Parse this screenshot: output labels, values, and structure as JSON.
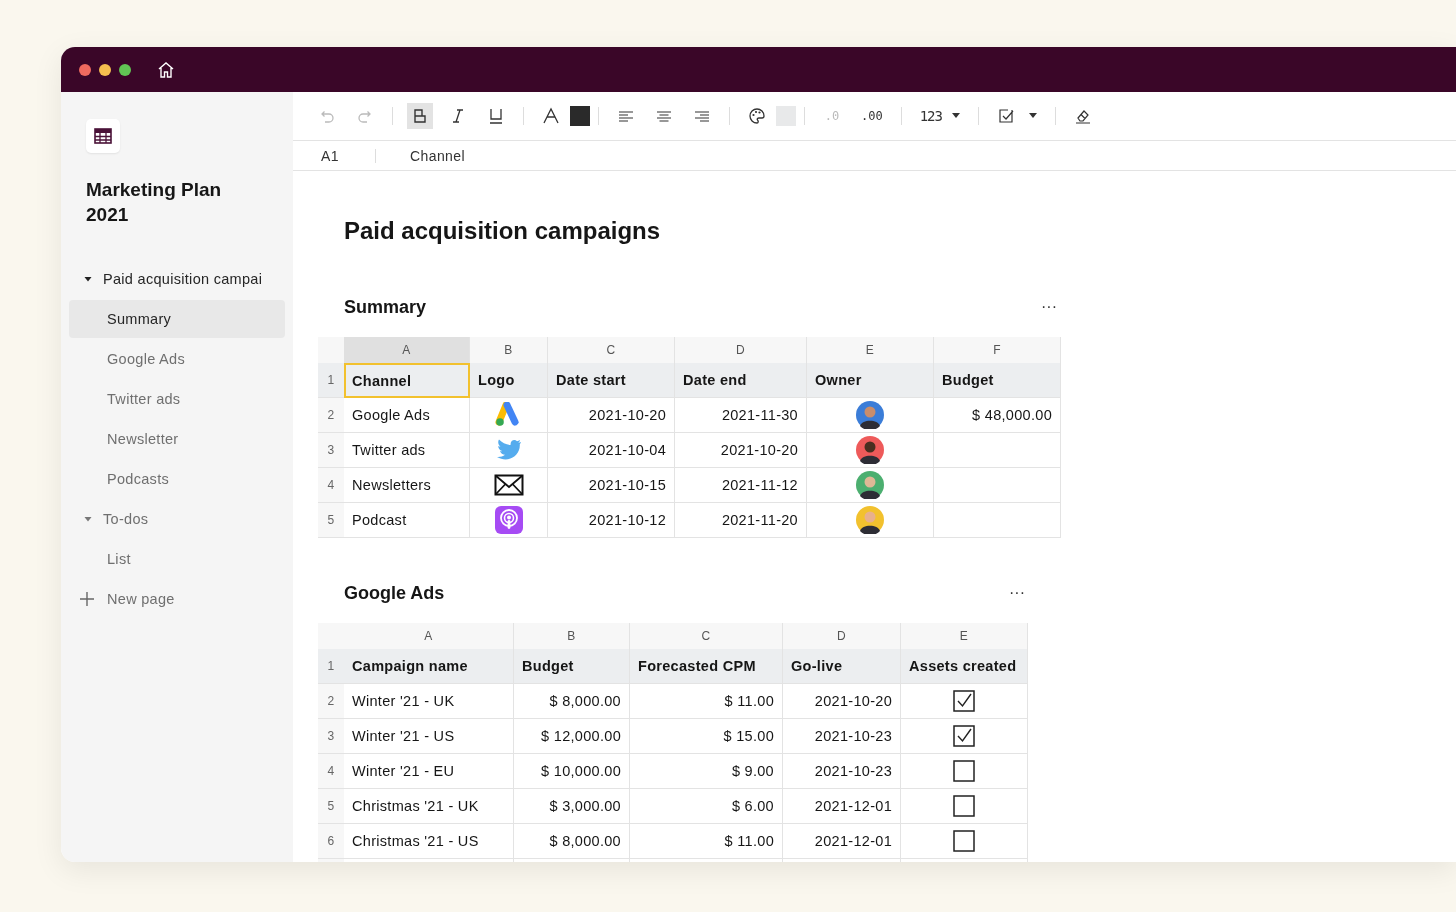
{
  "toolbar": {
    "bold": {
      "selected": true
    },
    "number_format": "123",
    "decrease_decimals": ".0",
    "increase_decimals": ".00"
  },
  "formula_bar": {
    "cell": "A1",
    "value": "Channel"
  },
  "sidebar": {
    "document_title": "Marketing Plan 2021",
    "items": [
      {
        "label": "Paid acquisition campai",
        "expanded": true,
        "selected": false,
        "children": [
          {
            "label": "Summary",
            "selected": true
          },
          {
            "label": "Google Ads",
            "selected": false
          },
          {
            "label": "Twitter ads",
            "selected": false
          },
          {
            "label": "Newsletter",
            "selected": false
          },
          {
            "label": "Podcasts",
            "selected": false
          }
        ]
      },
      {
        "label": "To-dos",
        "expanded": true,
        "selected": false,
        "children": [
          {
            "label": "List",
            "selected": false
          }
        ]
      }
    ],
    "new_page": "New page"
  },
  "page_title": "Paid acquisition campaigns",
  "summary": {
    "title": "Summary",
    "menu": "···",
    "header_row_number": "1",
    "columns": [
      {
        "letter": "A",
        "header": "Channel",
        "selected": true
      },
      {
        "letter": "B",
        "header": "Logo",
        "selected": false
      },
      {
        "letter": "C",
        "header": "Date start",
        "selected": false
      },
      {
        "letter": "D",
        "header": "Date end",
        "selected": false
      },
      {
        "letter": "E",
        "header": "Owner",
        "selected": false
      },
      {
        "letter": "F",
        "header": "Budget",
        "selected": false
      }
    ],
    "rows": [
      {
        "number": "2",
        "channel": "Google Ads",
        "date_start": "2021-10-20",
        "date_end": "2021-11-30",
        "budget": "$ 48,000.00"
      },
      {
        "number": "3",
        "channel": "Twitter ads",
        "date_start": "2021-10-04",
        "date_end": "2021-10-20"
      },
      {
        "number": "4",
        "channel": "Newsletters",
        "date_start": "2021-10-15",
        "date_end": "2021-11-12"
      },
      {
        "number": "5",
        "channel": "Podcast",
        "date_start": "2021-10-12",
        "date_end": "2021-11-20"
      }
    ]
  },
  "google_ads": {
    "title": "Google Ads",
    "menu": "···",
    "header_row_number": "1",
    "columns": [
      {
        "letter": "A",
        "header": "Campaign name"
      },
      {
        "letter": "B",
        "header": "Budget"
      },
      {
        "letter": "C",
        "header": "Forecasted CPM"
      },
      {
        "letter": "D",
        "header": "Go-live"
      },
      {
        "letter": "E",
        "header": "Assets created"
      }
    ],
    "rows": [
      {
        "number": "2",
        "name": "Winter '21 - UK",
        "budget": "$ 8,000.00",
        "cpm": "$ 11.00",
        "go_live": "2021-10-20",
        "checked": true
      },
      {
        "number": "3",
        "name": "Winter '21 - US",
        "budget": "$ 12,000.00",
        "cpm": "$ 15.00",
        "go_live": "2021-10-23",
        "checked": true
      },
      {
        "number": "4",
        "name": "Winter '21 - EU",
        "budget": "$ 10,000.00",
        "cpm": "$ 9.00",
        "go_live": "2021-10-23",
        "checked": false
      },
      {
        "number": "5",
        "name": "Christmas '21 - UK",
        "budget": "$ 3,000.00",
        "cpm": "$ 6.00",
        "go_live": "2021-12-01",
        "checked": false
      },
      {
        "number": "6",
        "name": "Christmas '21 - US",
        "budget": "$ 8,000.00",
        "cpm": "$ 11.00",
        "go_live": "2021-12-01",
        "checked": false
      }
    ]
  }
}
